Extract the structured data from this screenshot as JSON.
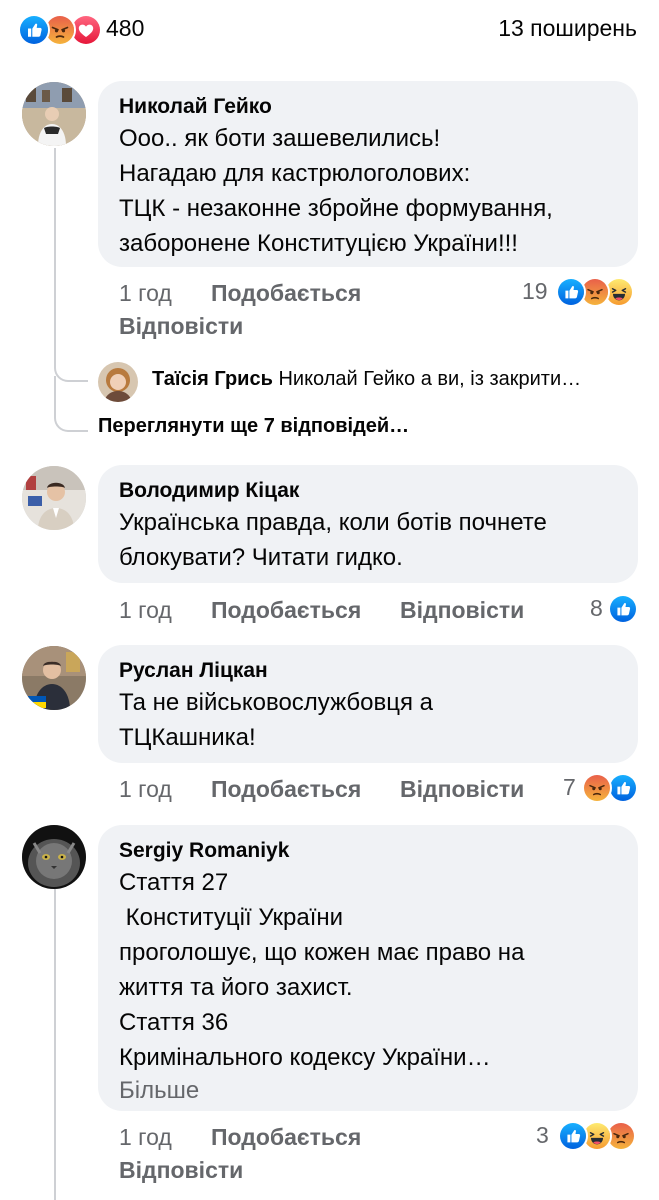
{
  "header": {
    "reaction_count": "480",
    "shares": "13 поширень",
    "reaction_icons": [
      "like-icon",
      "angry-icon",
      "love-icon"
    ]
  },
  "comments": [
    {
      "author": "Николай Гейко",
      "text": "Ооо.. як боти зашевелились!\nНагадаю для кастрюлоголових:\nТЦК - незаконне збройне формування,\nзаборонене Конституцією України!!!",
      "time": "1 год",
      "like_label": "Подобається",
      "reply_label": "Відповісти",
      "reaction_count": "19",
      "reaction_icons": [
        "like-icon",
        "angry-icon",
        "haha-icon"
      ],
      "replies": {
        "author": "Таїсія Грись",
        "snippet": "Николай Гейко а ви, із закрити…",
        "view_more": "Переглянути ще 7 відповідей…"
      }
    },
    {
      "author": "Володимир Кіцак",
      "text": "Українська правда, коли ботів почнете\nблокувати? Читати гидко.",
      "time": "1 год",
      "like_label": "Подобається",
      "reply_label": "Відповісти",
      "reaction_count": "8",
      "reaction_icons": [
        "like-icon"
      ]
    },
    {
      "author": "Руслан Ліцкан",
      "text": "Та не військовослужбовця а\nТЦКашника!",
      "time": "1 год",
      "like_label": "Подобається",
      "reply_label": "Відповісти",
      "reaction_count": "7",
      "reaction_icons": [
        "angry-icon",
        "like-icon"
      ]
    },
    {
      "author": "Sergiy Romaniyk",
      "text": "Стаття 27\n Конституції України\nпроголошує, що кожен має право на\nжиття та його захист.\nСтаття 36\nКримінального кодексу України…",
      "see_more": "Більше",
      "time": "1 год",
      "like_label": "Подобається",
      "reply_label": "Відповісти",
      "reaction_count": "3",
      "reaction_icons": [
        "like-icon",
        "haha-icon",
        "angry-icon"
      ]
    }
  ],
  "colors": {
    "like": "#1877f2",
    "love": "#f33e58",
    "angry": "#f0663a",
    "haha": "#f7b125",
    "bubble": "#f0f2f5",
    "secondary_text": "#65676b"
  }
}
